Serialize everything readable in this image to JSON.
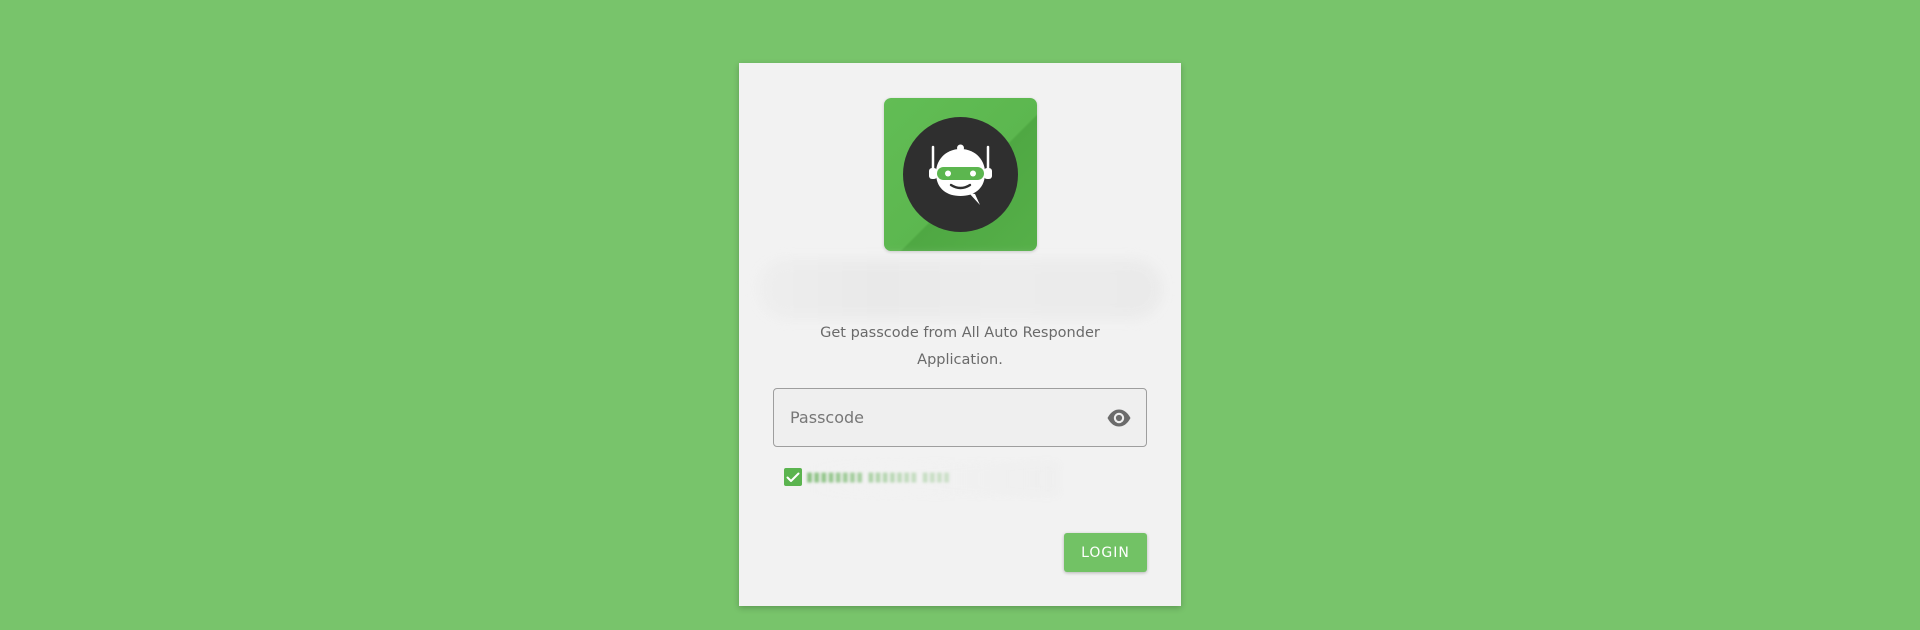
{
  "app": {
    "name": "All Auto Responder",
    "logo_icon": "robot-chat-icon",
    "colors": {
      "background": "#78c46b",
      "card": "#f2f2f2",
      "accent": "#5bb44f",
      "logo_circle": "#2f2f2f"
    }
  },
  "login": {
    "hint": "Get passcode from All Auto Responder Application.",
    "passcode": {
      "placeholder": "Passcode",
      "value": "",
      "toggle_icon": "eye-icon"
    },
    "remember": {
      "checked": true,
      "check_icon": "checkmark-icon"
    },
    "submit_label": "LOGIN"
  }
}
